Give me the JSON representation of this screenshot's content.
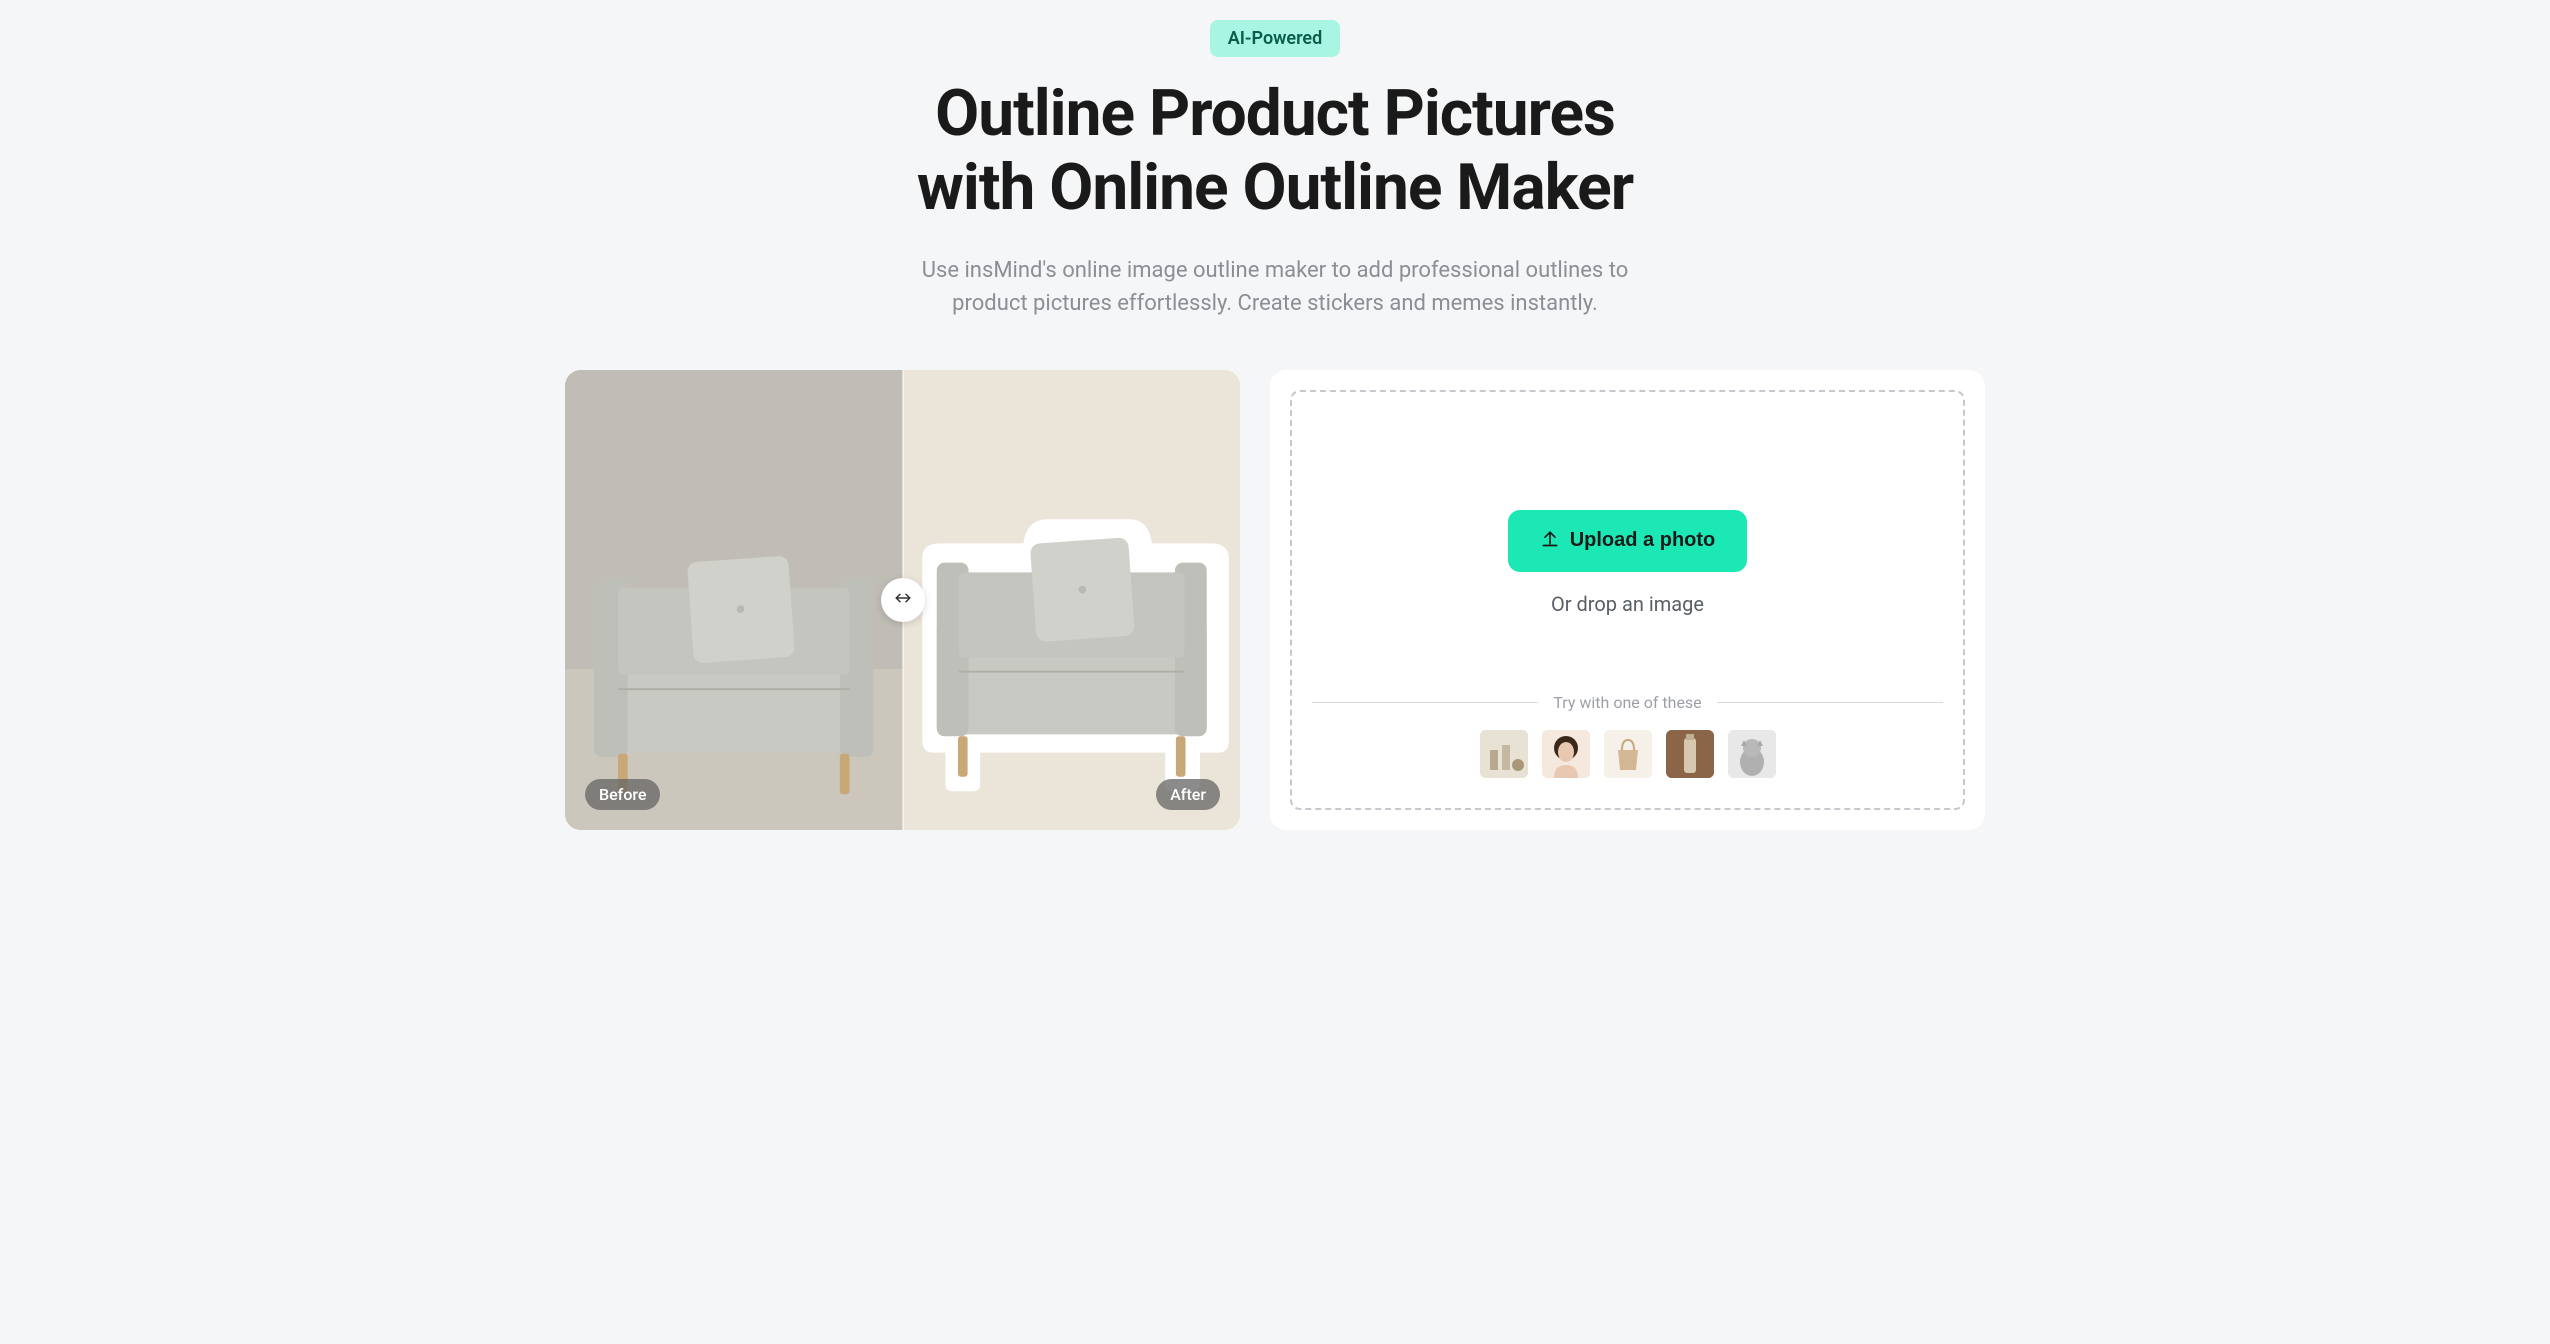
{
  "hero": {
    "badge": "AI-Powered",
    "title_line1": "Outline Product Pictures",
    "title_line2": "with Online Outline Maker",
    "subtitle": "Use insMind's online image outline maker to add professional outlines to product pictures effortlessly. Create stickers and memes instantly."
  },
  "preview": {
    "before_label": "Before",
    "after_label": "After"
  },
  "upload": {
    "button_label": "Upload a photo",
    "drop_text": "Or drop an image",
    "samples_label": "Try with one of these",
    "samples": [
      {
        "name": "sample-cosmetics"
      },
      {
        "name": "sample-portrait"
      },
      {
        "name": "sample-handbag"
      },
      {
        "name": "sample-bottle"
      },
      {
        "name": "sample-cat"
      }
    ]
  },
  "colors": {
    "accent": "#1ce8b5",
    "badge_bg": "#a8f5e4",
    "text_primary": "#1a1a1a",
    "text_secondary": "#8a8f96"
  }
}
